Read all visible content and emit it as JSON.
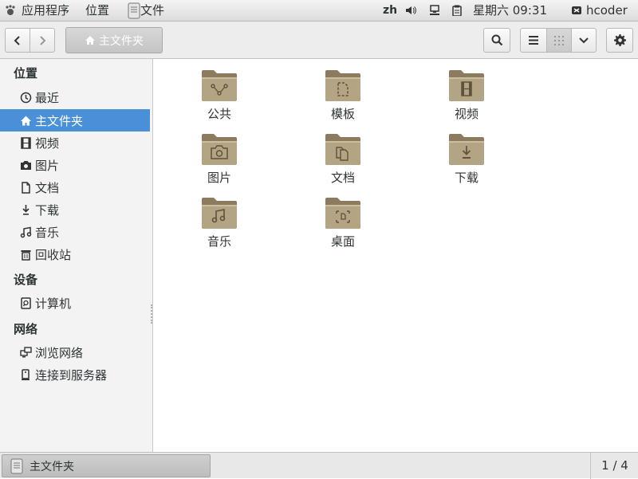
{
  "topbar": {
    "apps_label": "应用程序",
    "places_label": "位置",
    "window_label": "文件",
    "lang": "zh",
    "datetime": "星期六 09:31",
    "user": "hcoder"
  },
  "path": {
    "current": "主文件夹"
  },
  "sidebar": {
    "sections": [
      {
        "title": "位置",
        "items": [
          {
            "label": "最近",
            "icon": "recent-icon"
          },
          {
            "label": "主文件夹",
            "icon": "home-icon",
            "selected": true
          },
          {
            "label": "视频",
            "icon": "video-icon"
          },
          {
            "label": "图片",
            "icon": "camera-icon"
          },
          {
            "label": "文档",
            "icon": "document-icon"
          },
          {
            "label": "下载",
            "icon": "download-icon"
          },
          {
            "label": "音乐",
            "icon": "music-icon"
          },
          {
            "label": "回收站",
            "icon": "trash-icon"
          }
        ]
      },
      {
        "title": "设备",
        "items": [
          {
            "label": "计算机",
            "icon": "computer-icon"
          }
        ]
      },
      {
        "title": "网络",
        "items": [
          {
            "label": "浏览网络",
            "icon": "network-icon"
          },
          {
            "label": "连接到服务器",
            "icon": "server-icon"
          }
        ]
      }
    ]
  },
  "folders": [
    {
      "label": "公共",
      "icon": "share-icon"
    },
    {
      "label": "模板",
      "icon": "template-icon"
    },
    {
      "label": "视频",
      "icon": "video-icon"
    },
    {
      "label": "图片",
      "icon": "camera-icon"
    },
    {
      "label": "文档",
      "icon": "document-icon"
    },
    {
      "label": "下载",
      "icon": "download-icon"
    },
    {
      "label": "音乐",
      "icon": "music-icon"
    },
    {
      "label": "桌面",
      "icon": "desktop-icon"
    }
  ],
  "taskbar": {
    "window_title": "主文件夹",
    "workspace": "1 / 4"
  },
  "colors": {
    "accent": "#4a90d9",
    "folder": "#a8987a"
  }
}
